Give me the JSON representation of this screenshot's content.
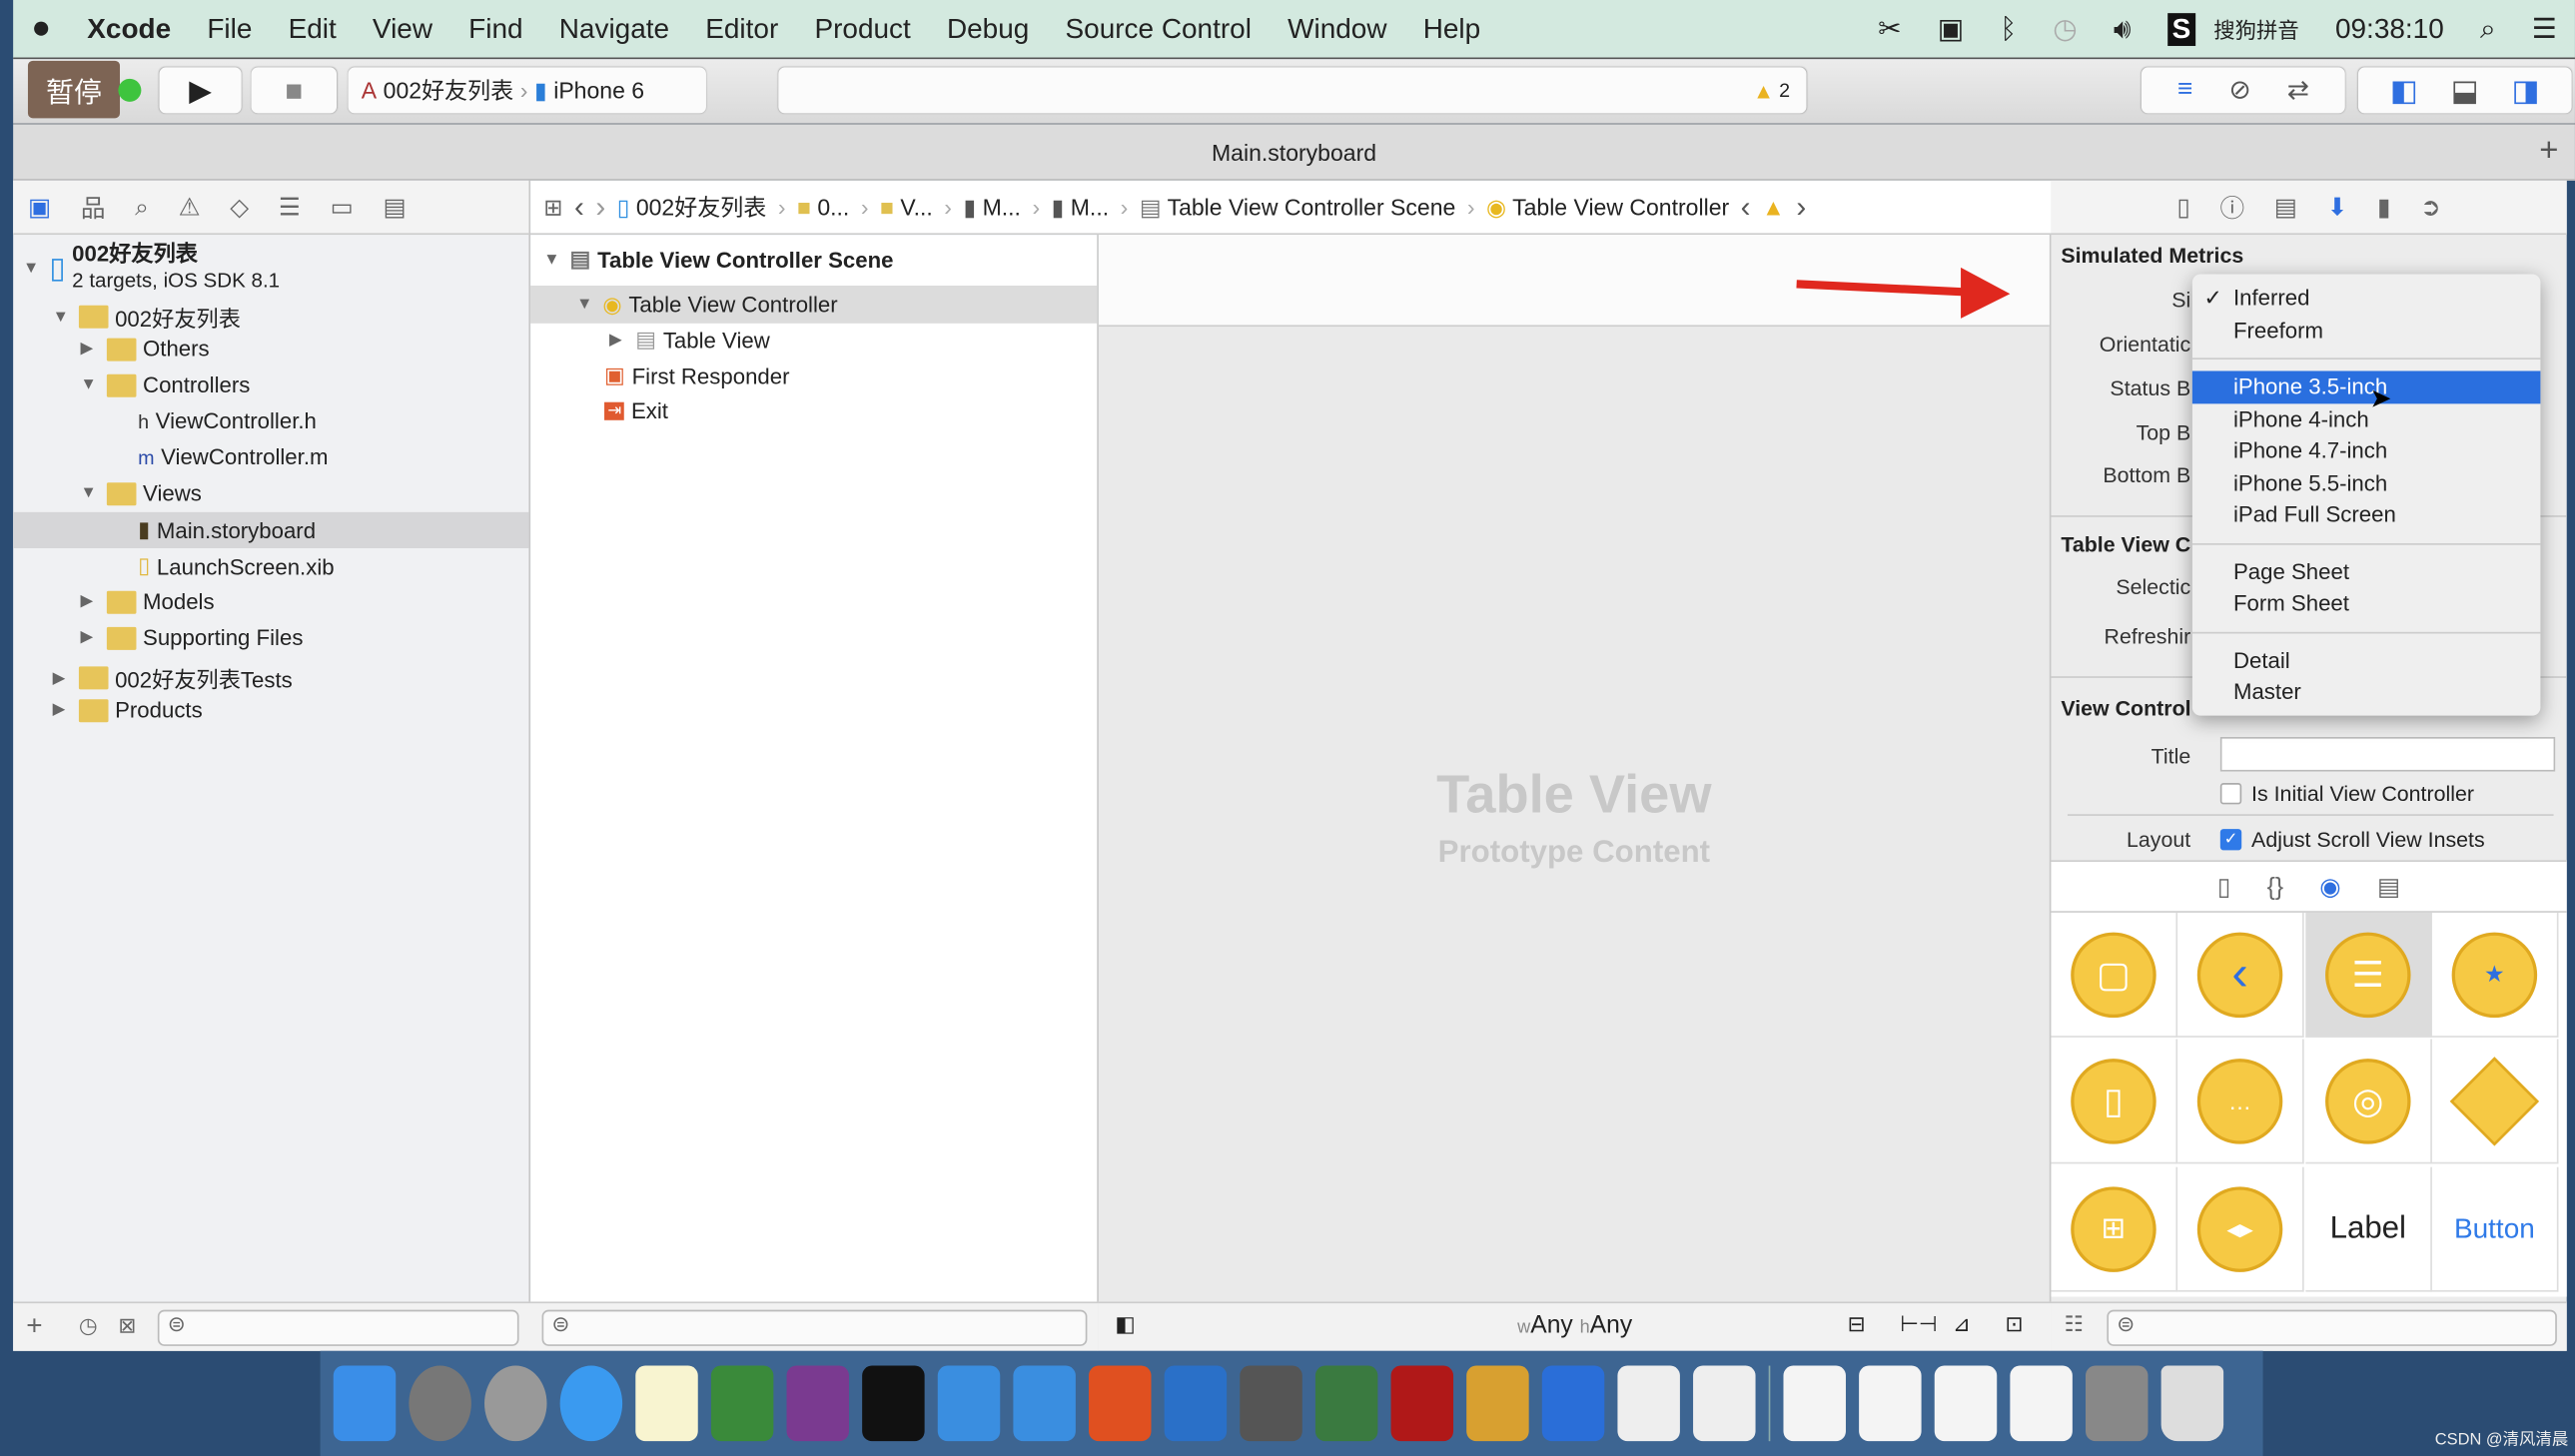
{
  "menubar": {
    "apple": "",
    "app": "Xcode",
    "items": [
      "File",
      "Edit",
      "View",
      "Find",
      "Navigate",
      "Editor",
      "Product",
      "Debug",
      "Source Control",
      "Window",
      "Help"
    ],
    "ime": "搜狗拼音",
    "clock": "09:38:10"
  },
  "toolbar": {
    "pause_badge": "暂停",
    "scheme": "002好友列表",
    "device": "iPhone 6",
    "warning_count": "2"
  },
  "tab": {
    "title": "Main.storyboard"
  },
  "jumpbar": [
    "002好友列表",
    "0...",
    "V...",
    "M...",
    "M...",
    "Table View Controller Scene",
    "Table View Controller"
  ],
  "navigator": {
    "project": "002好友列表",
    "project_sub": "2 targets, iOS SDK 8.1",
    "items": [
      {
        "label": "002好友列表",
        "kind": "folder"
      },
      {
        "label": "Others",
        "kind": "folder"
      },
      {
        "label": "Controllers",
        "kind": "folder"
      },
      {
        "label": "ViewController.h",
        "kind": "h"
      },
      {
        "label": "ViewController.m",
        "kind": "m"
      },
      {
        "label": "Views",
        "kind": "folder"
      },
      {
        "label": "Main.storyboard",
        "kind": "storyboard"
      },
      {
        "label": "LaunchScreen.xib",
        "kind": "xib"
      },
      {
        "label": "Models",
        "kind": "folder"
      },
      {
        "label": "Supporting Files",
        "kind": "folder"
      },
      {
        "label": "002好友列表Tests",
        "kind": "folder"
      },
      {
        "label": "Products",
        "kind": "folder"
      }
    ]
  },
  "outline": {
    "scene": "Table View Controller Scene",
    "controller": "Table View Controller",
    "table": "Table View",
    "responder": "First Responder",
    "exit": "Exit"
  },
  "canvas": {
    "title": "Table View",
    "subtitle": "Prototype Content",
    "size_w": "Any",
    "size_h": "Any",
    "w_prefix": "w",
    "h_prefix": "h"
  },
  "inspector": {
    "section1": "Simulated Metrics",
    "labels": [
      "Si",
      "Orientatic",
      "Status B",
      "Top B",
      "Bottom B"
    ],
    "section2": "Table View C",
    "labels2": [
      "Selectic",
      "Refreshir"
    ],
    "section3": "View Control",
    "title_label": "Title",
    "title_value": "",
    "initial_label": "Is Initial View Controller",
    "initial_checked": false,
    "layout_label": "Layout",
    "adjust_label": "Adjust Scroll View Insets",
    "adjust_checked": true
  },
  "size_menu": {
    "selected": "Inferred",
    "highlighted": "iPhone 3.5-inch",
    "groups": [
      [
        "Inferred",
        "Freeform"
      ],
      [
        "iPhone 3.5-inch",
        "iPhone 4-inch",
        "iPhone 4.7-inch",
        "iPhone 5.5-inch",
        "iPad Full Screen"
      ],
      [
        "Page Sheet",
        "Form Sheet"
      ],
      [
        "Detail",
        "Master"
      ]
    ]
  },
  "library": {
    "label_item": "Label",
    "button_item": "Button"
  },
  "watermark": "CSDN @清风清晨",
  "colors": {
    "accent": "#2f6fe0",
    "folder": "#e7c55a",
    "library_yellow": "#f6c944",
    "arrow": "#e0281e"
  }
}
